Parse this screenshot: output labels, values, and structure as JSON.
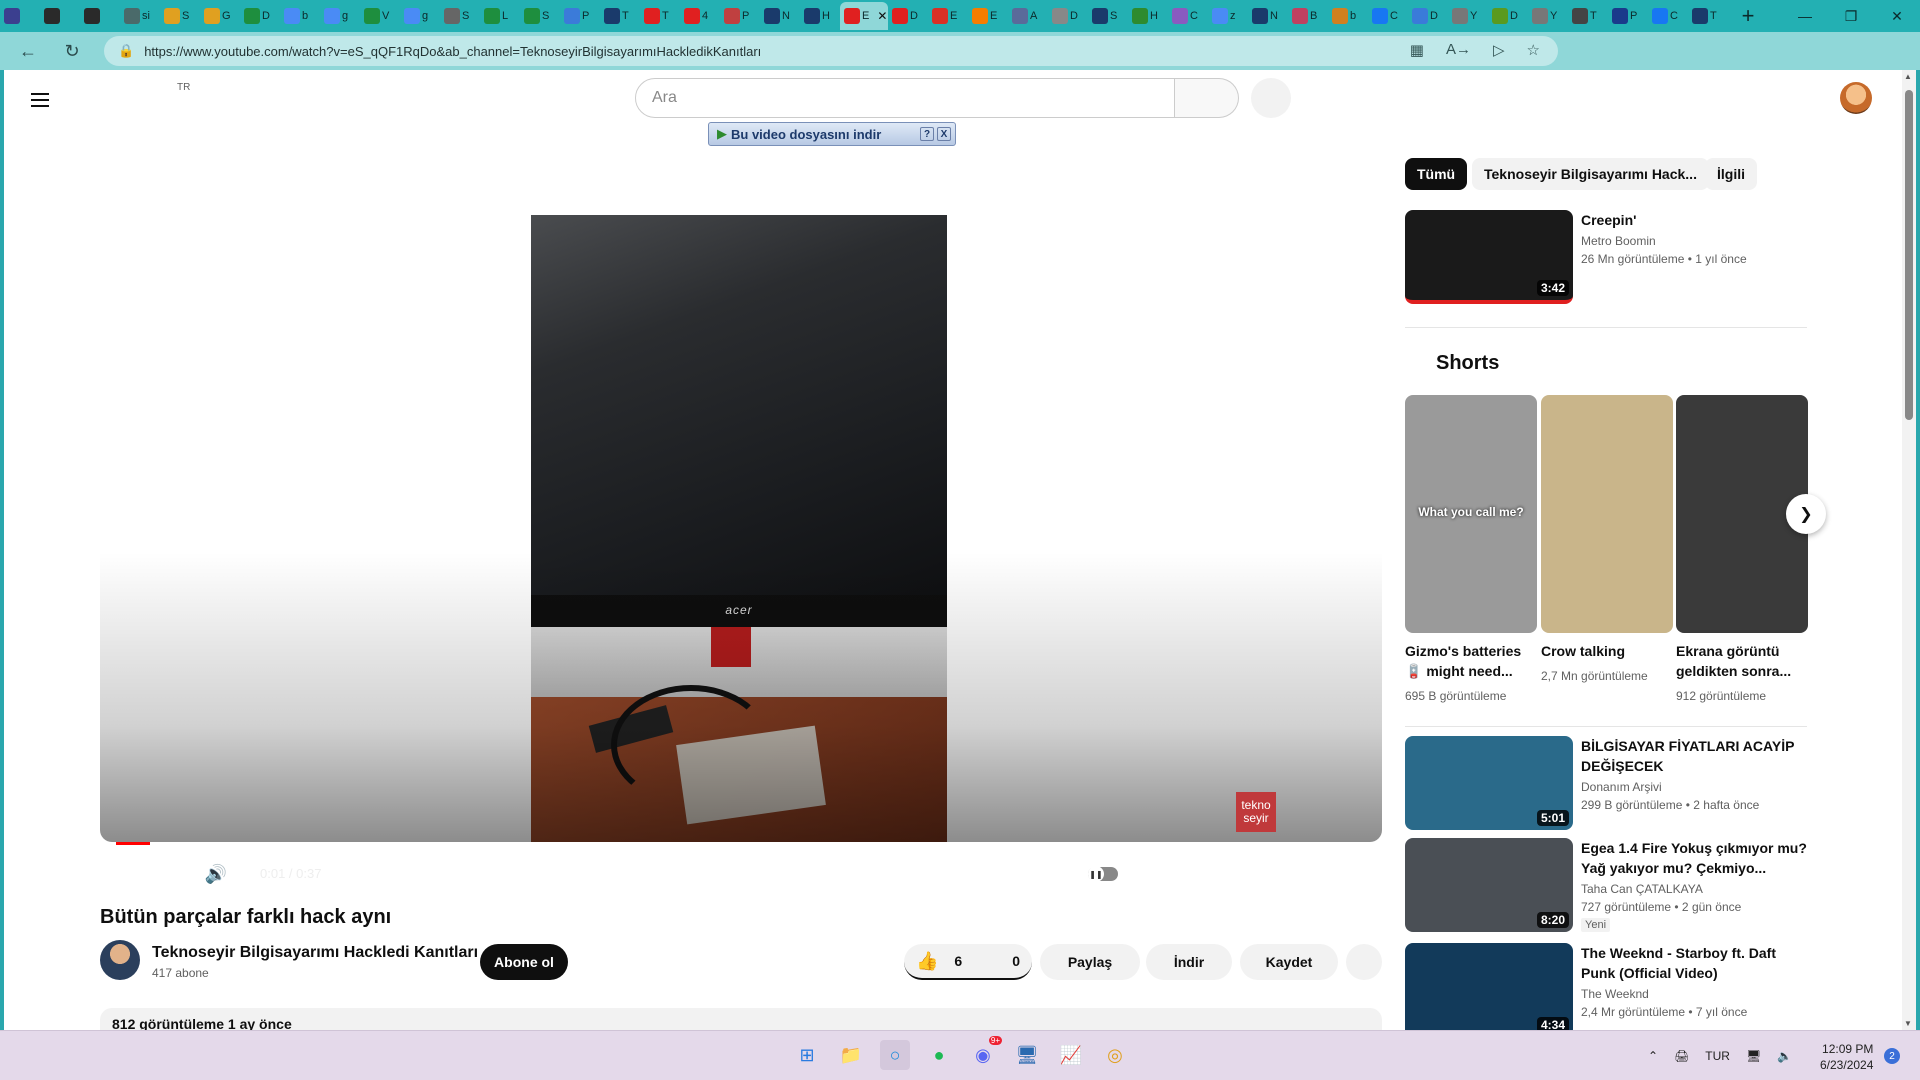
{
  "browser": {
    "tabs": [
      {
        "icon": "app-icon",
        "color": "#3b3f8f",
        "t": ""
      },
      {
        "icon": "workspaces-icon",
        "color": "#2a2a2a",
        "t": ""
      },
      {
        "icon": "tab-actions-icon",
        "color": "#2a2a2a",
        "t": ""
      },
      {
        "icon": "page-icon",
        "color": "#4a6a6a",
        "t": "si"
      },
      {
        "icon": "drive-icon",
        "color": "#e0a020",
        "t": "S"
      },
      {
        "icon": "drive-icon",
        "color": "#e0a020",
        "t": "G"
      },
      {
        "icon": "drive-icon",
        "color": "#1e8e3e",
        "t": "D"
      },
      {
        "icon": "google-icon",
        "color": "#4a8bf5",
        "t": "b"
      },
      {
        "icon": "google-icon",
        "color": "#4a8bf5",
        "t": "g"
      },
      {
        "icon": "sheets-icon",
        "color": "#1e8e3e",
        "t": "V"
      },
      {
        "icon": "google-icon",
        "color": "#4a8bf5",
        "t": "g"
      },
      {
        "icon": "wiki-icon",
        "color": "#666",
        "t": "S"
      },
      {
        "icon": "drive-icon",
        "color": "#1e8e3e",
        "t": "L"
      },
      {
        "icon": "drive-icon",
        "color": "#1e8e3e",
        "t": "S"
      },
      {
        "icon": "arrow-icon",
        "color": "#3b7bd9",
        "t": "P"
      },
      {
        "icon": "tumblr-icon",
        "color": "#1a3a6b",
        "t": "T"
      },
      {
        "icon": "youtube-icon",
        "color": "#e02020",
        "t": "T"
      },
      {
        "icon": "youtube-icon",
        "color": "#e02020",
        "t": "4"
      },
      {
        "icon": "page-icon",
        "color": "#c04040",
        "t": "P"
      },
      {
        "icon": "tumblr-icon",
        "color": "#1a3a6b",
        "t": "N"
      },
      {
        "icon": "tumblr-icon",
        "color": "#1a3a6b",
        "t": "H"
      },
      {
        "icon": "youtube-icon",
        "color": "#e02020",
        "t": "E",
        "active": true
      },
      {
        "icon": "youtube-icon",
        "color": "#e02020",
        "t": "D"
      },
      {
        "icon": "gmail-icon",
        "color": "#d93025",
        "t": "E"
      },
      {
        "icon": "blogger-icon",
        "color": "#f57d00",
        "t": "E"
      },
      {
        "icon": "page-icon",
        "color": "#5a6a9a",
        "t": "A"
      },
      {
        "icon": "page-icon",
        "color": "#888",
        "t": "D"
      },
      {
        "icon": "tumblr-icon",
        "color": "#1a3a6b",
        "t": "S"
      },
      {
        "icon": "page-icon",
        "color": "#2e8b2e",
        "t": "H"
      },
      {
        "icon": "page-icon",
        "color": "#8a5ac0",
        "t": "C"
      },
      {
        "icon": "google-icon",
        "color": "#4a8bf5",
        "t": "z"
      },
      {
        "icon": "tumblr-icon",
        "color": "#1a3a6b",
        "t": "N"
      },
      {
        "icon": "page-icon",
        "color": "#c04060",
        "t": "B"
      },
      {
        "icon": "page-icon",
        "color": "#d08020",
        "t": "b"
      },
      {
        "icon": "facebook-icon",
        "color": "#1877f2",
        "t": "C"
      },
      {
        "icon": "page-icon",
        "color": "#3a7bd9",
        "t": "D"
      },
      {
        "icon": "mail-icon",
        "color": "#777",
        "t": "Y"
      },
      {
        "icon": "page-icon",
        "color": "#5a9a20",
        "t": "D"
      },
      {
        "icon": "mail-icon",
        "color": "#777",
        "t": "Y"
      },
      {
        "icon": "doc-icon",
        "color": "#444",
        "t": "T"
      },
      {
        "icon": "paypal-icon",
        "color": "#1a3a8b",
        "t": "P"
      },
      {
        "icon": "facebook-icon",
        "color": "#1877f2",
        "t": "C"
      },
      {
        "icon": "tumblr-icon",
        "color": "#1a3a6b",
        "t": "T"
      }
    ],
    "url": "https://www.youtube.com/watch?v=eS_qQF1RqDo&ab_channel=TeknoseyirBilgisayarımıHackledikKanıtları"
  },
  "masthead": {
    "country": "TR",
    "search_placeholder": "Ara"
  },
  "downloader": {
    "label": "Bu video dosyasını indir",
    "help": "?",
    "close": "X"
  },
  "player": {
    "brand_on_monitor": "acer",
    "watermark": "tekno seyir",
    "time": "0:01 / 0:37",
    "progress_played": 0.027,
    "progress_loaded": 0.39
  },
  "video": {
    "title": "Bütün parçalar farklı hack aynı",
    "channel": "Teknoseyir Bilgisayarımı Hackledi Kanıtları",
    "subscribers": "417 abone",
    "subscribe_label": "Abone ol",
    "likes": "6",
    "dislikes": "0",
    "share_label": "Paylaş",
    "download_label": "İndir",
    "save_label": "Kaydet",
    "description_preview": "812 görüntüleme  1 ay önce"
  },
  "sidebar": {
    "chips": [
      "Tümü",
      "Teknoseyir Bilgisayarımı Hack...",
      "İlgili"
    ],
    "recommendations": [
      {
        "title": "Creepin'",
        "channel": "Metro Boomin",
        "meta": "26 Mn görüntüleme  • 1 yıl önce",
        "duration": "3:42",
        "thumb": "#1a1a1a"
      },
      {
        "title": "BİLGİSAYAR FİYATLARI ACAYİP DEĞİŞECEK",
        "channel": "Donanım Arşivi",
        "meta": "299 B görüntüleme  • 2 hafta önce",
        "duration": "5:01",
        "thumb": "#2a6a8a"
      },
      {
        "title": "Egea 1.4 Fire Yokuş çıkmıyor mu? Yağ yakıyor mu? Çekmiyo...",
        "channel": "Taha Can ÇATALKAYA",
        "meta": "727 görüntüleme  • 2 gün önce",
        "badge": "Yeni",
        "duration": "8:20",
        "thumb": "#4a4f55"
      },
      {
        "title": "The Weeknd - Starboy ft. Daft Punk (Official Video)",
        "channel": "The Weeknd",
        "meta": "2,4 Mr görüntüleme  • 7 yıl önce",
        "duration": "4:34",
        "thumb": "#123a5a"
      }
    ],
    "shorts_heading": "Shorts",
    "shorts": [
      {
        "title": "Gizmo's batteries 🪫 might need...",
        "views": "695 B görüntüleme",
        "overlay": "What you call me?",
        "thumb": "#9a9a9a"
      },
      {
        "title": "Crow talking",
        "views": "2,7 Mn görüntüleme",
        "thumb": "#c9b58a"
      },
      {
        "title": "Ekrana görüntü geldikten sonra...",
        "views": "912 görüntüleme",
        "thumb": "#3a3a3a"
      }
    ]
  },
  "taskbar": {
    "tray_lang": "TUR",
    "time": "12:09 PM",
    "date": "6/23/2024",
    "notifications": "2",
    "discord_badge": "9+"
  }
}
